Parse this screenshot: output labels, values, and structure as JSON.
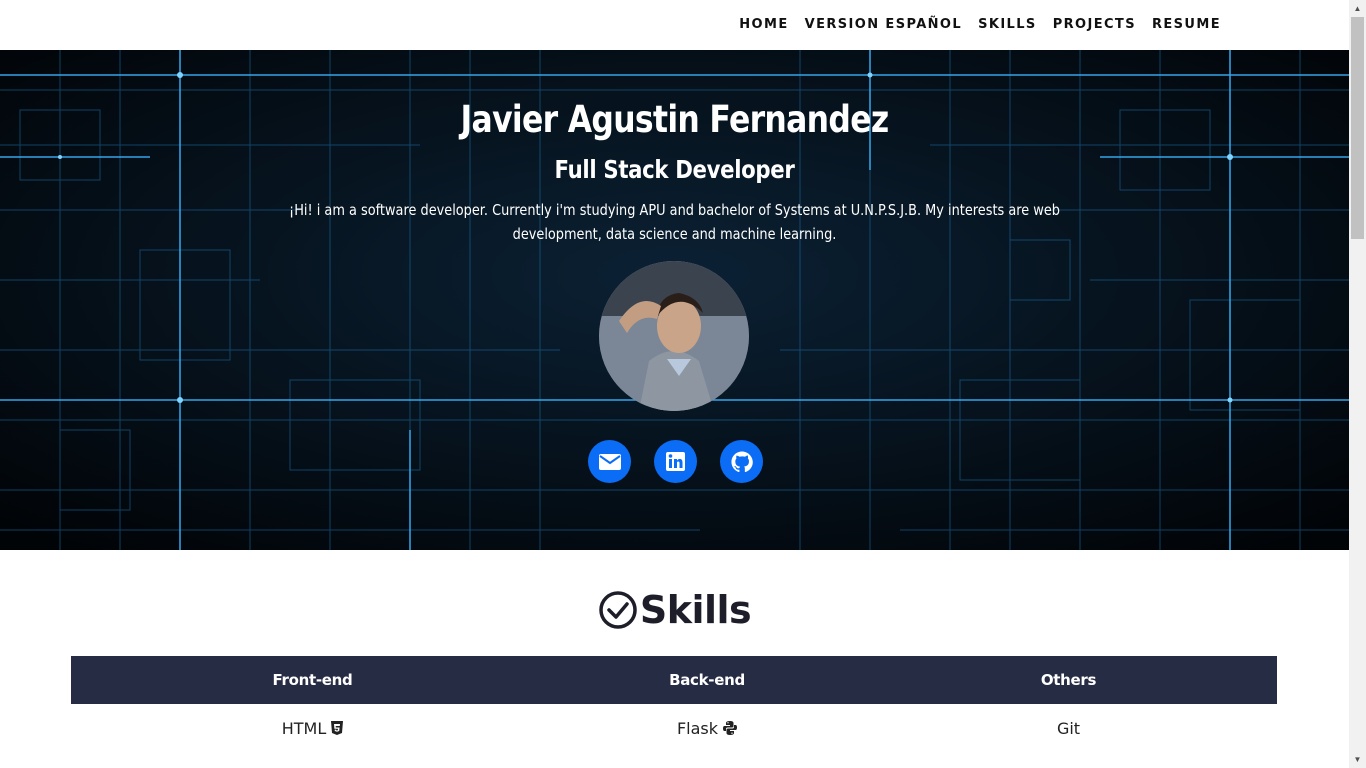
{
  "nav": {
    "items": [
      {
        "label": "HOME"
      },
      {
        "label": "VERSION ESPAÑOL"
      },
      {
        "label": "SKILLS"
      },
      {
        "label": "PROJECTS"
      },
      {
        "label": "RESUME"
      }
    ]
  },
  "hero": {
    "name": "Javier Agustin Fernandez",
    "role": "Full Stack Developer",
    "bio": "¡Hi! i am a software developer. Currently i'm studying APU and bachelor of Systems at U.N.P.S.J.B. My interests are web development, data science and machine learning.",
    "social": [
      {
        "icon": "envelope-icon"
      },
      {
        "icon": "linkedin-icon"
      },
      {
        "icon": "github-icon"
      }
    ],
    "accent": "#0b6df5"
  },
  "skills": {
    "title": "Skills",
    "columns": [
      "Front-end",
      "Back-end",
      "Others"
    ],
    "rows": [
      [
        "HTML",
        "Flask",
        "Git"
      ]
    ],
    "header_color": "#272c45"
  }
}
